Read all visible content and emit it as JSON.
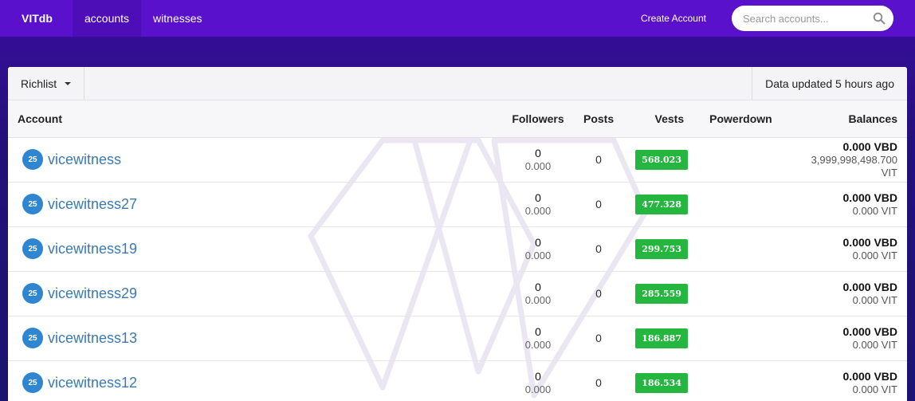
{
  "navbar": {
    "brand": "VITdb",
    "links": [
      {
        "label": "accounts",
        "active": true
      },
      {
        "label": "witnesses",
        "active": false
      }
    ],
    "create_account": "Create Account",
    "search_placeholder": "Search accounts..."
  },
  "card": {
    "dropdown_label": "Richlist",
    "updated_text": "Data updated 5 hours ago"
  },
  "table": {
    "headers": {
      "account": "Account",
      "followers": "Followers",
      "posts": "Posts",
      "vests": "Vests",
      "powerdown": "Powerdown",
      "balances": "Balances"
    },
    "rows": [
      {
        "rep": "25",
        "name": "vicewitness",
        "followers": "0",
        "followers_sub": "0.000",
        "posts": "0",
        "vests": "568.023",
        "powerdown": "",
        "bal_vbd": "0.000 VBD",
        "bal_vit": "3,999,998,498.700 VIT"
      },
      {
        "rep": "25",
        "name": "vicewitness27",
        "followers": "0",
        "followers_sub": "0.000",
        "posts": "0",
        "vests": "477.328",
        "powerdown": "",
        "bal_vbd": "0.000 VBD",
        "bal_vit": "0.000 VIT"
      },
      {
        "rep": "25",
        "name": "vicewitness19",
        "followers": "0",
        "followers_sub": "0.000",
        "posts": "0",
        "vests": "299.753",
        "powerdown": "",
        "bal_vbd": "0.000 VBD",
        "bal_vit": "0.000 VIT"
      },
      {
        "rep": "25",
        "name": "vicewitness29",
        "followers": "0",
        "followers_sub": "0.000",
        "posts": "0",
        "vests": "285.559",
        "powerdown": "",
        "bal_vbd": "0.000 VBD",
        "bal_vit": "0.000 VIT"
      },
      {
        "rep": "25",
        "name": "vicewitness13",
        "followers": "0",
        "followers_sub": "0.000",
        "posts": "0",
        "vests": "186.887",
        "powerdown": "",
        "bal_vbd": "0.000 VBD",
        "bal_vit": "0.000 VIT"
      },
      {
        "rep": "25",
        "name": "vicewitness12",
        "followers": "0",
        "followers_sub": "0.000",
        "posts": "0",
        "vests": "186.534",
        "powerdown": "",
        "bal_vbd": "0.000 VBD",
        "bal_vit": "0.000 VIT"
      }
    ]
  },
  "colors": {
    "navbar": "#5a11cc",
    "vest_badge": "#25b63f",
    "rep_badge": "#2e86d0",
    "account_link": "#3a7ab3"
  },
  "icons": {
    "search": "search-icon",
    "dropdown": "caret-down-icon",
    "watermark": "vit-logo-watermark"
  }
}
